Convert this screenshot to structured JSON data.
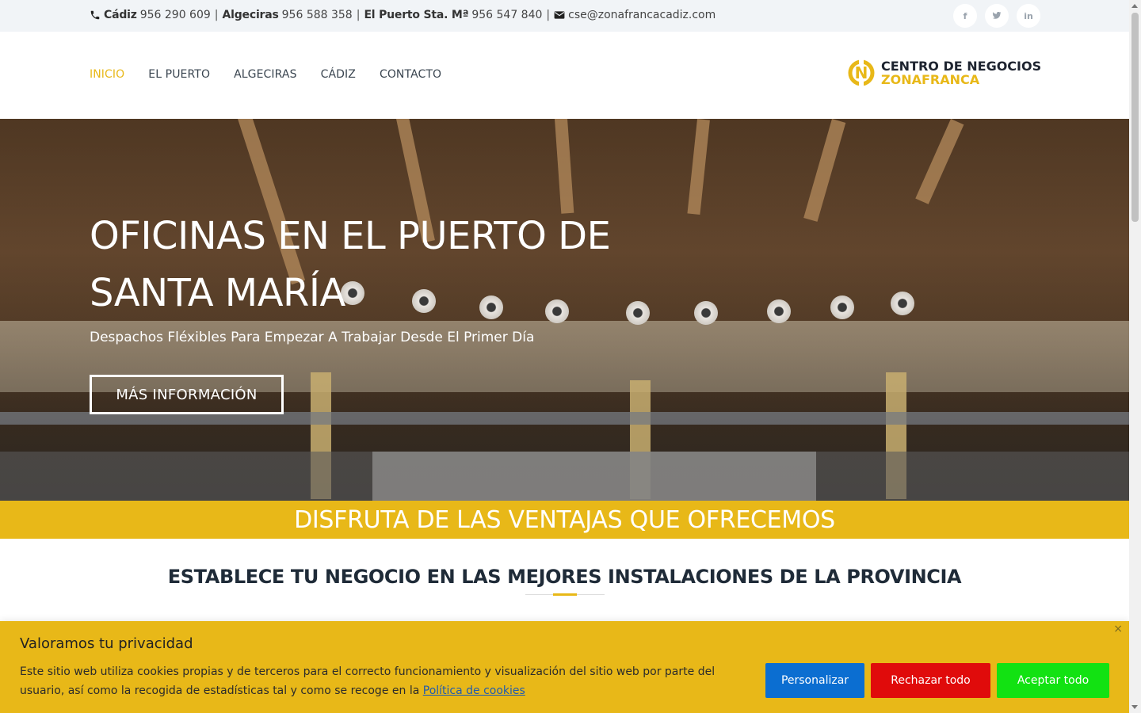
{
  "topbar": {
    "contacts": [
      {
        "city": "Cádiz",
        "phone": "956 290 609"
      },
      {
        "city": "Algeciras",
        "phone": "956 588 358"
      },
      {
        "city": "El Puerto Sta. Mª",
        "phone": "956 547 840"
      }
    ],
    "separator": "|",
    "email": "cse@zonafrancacadiz.com",
    "social": [
      {
        "icon": "facebook-icon",
        "glyph": "f"
      },
      {
        "icon": "twitter-icon",
        "glyph": "t"
      },
      {
        "icon": "linkedin-icon",
        "glyph": "in"
      }
    ]
  },
  "nav": {
    "items": [
      "INICIO",
      "EL PUERTO",
      "ALGECIRAS",
      "CÁDIZ",
      "CONTACTO"
    ],
    "active_index": 0
  },
  "logo": {
    "line1": "CENTRO DE NEGOCIOS",
    "line2": "ZONAFRANCA",
    "mark_letter": "N"
  },
  "hero": {
    "title": "OFICINAS EN EL PUERTO DE SANTA MARÍA",
    "subtitle": "Despachos Fléxibles Para Empezar A Trabajar Desde El Primer Día",
    "button": "MÁS INFORMACIÓN"
  },
  "band": {
    "text": "DISFRUTA DE LAS VENTAJAS QUE OFRECEMOS"
  },
  "section": {
    "title": "ESTABLECE TU NEGOCIO EN LAS MEJORES INSTALACIONES DE LA PROVINCIA"
  },
  "cookie": {
    "title": "Valoramos tu privacidad",
    "text": "Este sitio web utiliza cookies propias y de terceros para el correcto funcionamiento y visualización del sitio web por parte del usuario, así como la recogida de estadísticas tal y como se recoge en la",
    "link": "Política de cookies",
    "close": "×",
    "buttons": {
      "personalize": "Personalizar",
      "reject": "Rechazar todo",
      "accept": "Aceptar todo"
    }
  },
  "colors": {
    "accent": "#e8b818",
    "personalize": "#0b6ed1",
    "reject": "#e00b0b",
    "accept": "#12e212"
  }
}
